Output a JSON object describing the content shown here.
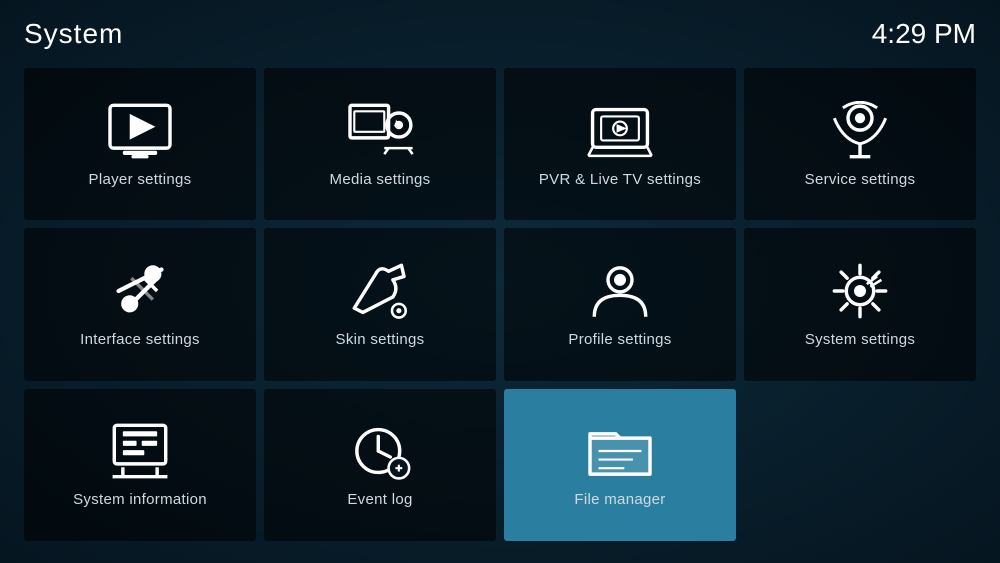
{
  "header": {
    "title": "System",
    "time": "4:29 PM"
  },
  "tiles": [
    {
      "id": "player-settings",
      "label": "Player settings",
      "icon": "player",
      "active": false
    },
    {
      "id": "media-settings",
      "label": "Media settings",
      "icon": "media",
      "active": false
    },
    {
      "id": "pvr-settings",
      "label": "PVR & Live TV settings",
      "icon": "pvr",
      "active": false
    },
    {
      "id": "service-settings",
      "label": "Service settings",
      "icon": "service",
      "active": false
    },
    {
      "id": "interface-settings",
      "label": "Interface settings",
      "icon": "interface",
      "active": false
    },
    {
      "id": "skin-settings",
      "label": "Skin settings",
      "icon": "skin",
      "active": false
    },
    {
      "id": "profile-settings",
      "label": "Profile settings",
      "icon": "profile",
      "active": false
    },
    {
      "id": "system-settings",
      "label": "System settings",
      "icon": "system",
      "active": false
    },
    {
      "id": "system-information",
      "label": "System information",
      "icon": "sysinfo",
      "active": false
    },
    {
      "id": "event-log",
      "label": "Event log",
      "icon": "eventlog",
      "active": false
    },
    {
      "id": "file-manager",
      "label": "File manager",
      "icon": "filemanager",
      "active": true
    }
  ]
}
